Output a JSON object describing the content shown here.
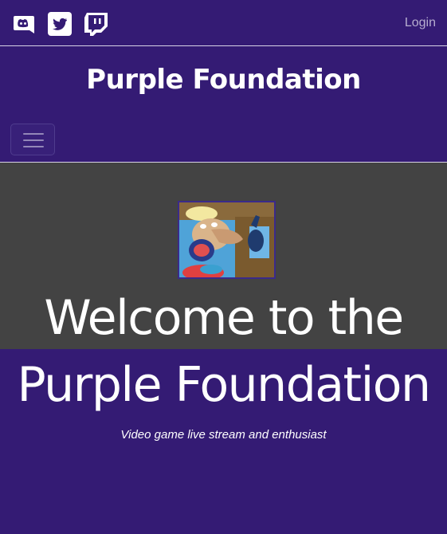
{
  "topbar": {
    "social": [
      {
        "icon": "discord-icon"
      },
      {
        "icon": "twitter-icon"
      },
      {
        "icon": "twitch-icon"
      }
    ],
    "login_label": "Login"
  },
  "brand": {
    "title": "Purple Foundation"
  },
  "navbar": {
    "toggler_icon": "hamburger-menu-icon"
  },
  "hero": {
    "title_line1": "Welcome to the",
    "title_line2": "Purple Foundation",
    "tagline": "Video game live stream and enthusiast",
    "avatar_image": "cartoon-character-avatar"
  },
  "colors": {
    "background": "#341b74",
    "hero_band": "#434343",
    "text": "#ffffff",
    "login_text": "#b6adcf"
  }
}
